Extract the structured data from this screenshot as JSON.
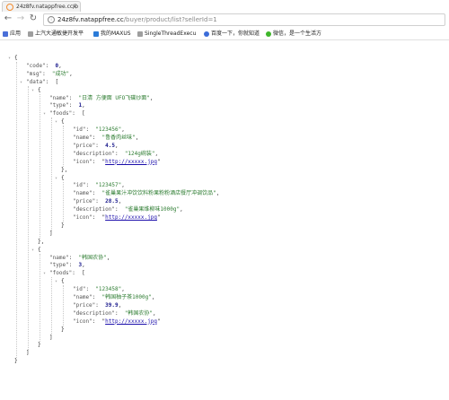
{
  "browser": {
    "tab_title": "24z8fv.natappfree.cc/b",
    "url_host": "24z8fv.natappfree.cc",
    "url_path": "/buyer/product/list?sellerId=1",
    "bookmarks": [
      {
        "label": "应用",
        "color": "#4a6fd8"
      },
      {
        "label": "上汽大通敏捷开发平",
        "color": "#9e9e9e"
      },
      {
        "label": "我的MAXUS",
        "color": "#2b7bd8"
      },
      {
        "label": "SingleThreadExecu",
        "color": "#9e9e9e"
      },
      {
        "label": "百度一下，你就知道",
        "color": "#3b6cd9"
      },
      {
        "label": "微信，是一个生活方",
        "color": "#3fb62a"
      }
    ]
  },
  "json_lines": [
    [
      [
        "p",
        "{"
      ]
    ],
    [
      [
        "k",
        "\"code\""
      ],
      [
        "p",
        ":  "
      ],
      [
        "n",
        "0"
      ],
      [
        "p",
        ","
      ]
    ],
    [
      [
        "k",
        "\"msg\""
      ],
      [
        "p",
        ":  "
      ],
      [
        "s",
        "\"成功\""
      ],
      [
        "p",
        ","
      ]
    ],
    [
      [
        "k",
        "\"data\""
      ],
      [
        "p",
        ":  ["
      ]
    ],
    [
      [
        "p",
        "{"
      ]
    ],
    [
      [
        "k",
        "\"name\""
      ],
      [
        "p",
        ":  "
      ],
      [
        "s",
        "\"日清 方便面 UFO飞碟炒面\""
      ],
      [
        "p",
        ","
      ]
    ],
    [
      [
        "k",
        "\"type\""
      ],
      [
        "p",
        ":  "
      ],
      [
        "n",
        "1"
      ],
      [
        "p",
        ","
      ]
    ],
    [
      [
        "k",
        "\"foods\""
      ],
      [
        "p",
        ":  ["
      ]
    ],
    [
      [
        "p",
        "{"
      ]
    ],
    [
      [
        "k",
        "\"id\""
      ],
      [
        "p",
        ":  "
      ],
      [
        "s",
        "\"123456\""
      ],
      [
        "p",
        ","
      ]
    ],
    [
      [
        "k",
        "\"name\""
      ],
      [
        "p",
        ":  "
      ],
      [
        "s",
        "\"鲁香肉丝味\""
      ],
      [
        "p",
        ","
      ]
    ],
    [
      [
        "k",
        "\"price\""
      ],
      [
        "p",
        ":  "
      ],
      [
        "n",
        "4.5"
      ],
      [
        "p",
        ","
      ]
    ],
    [
      [
        "k",
        "\"description\""
      ],
      [
        "p",
        ":  "
      ],
      [
        "s",
        "\"124g碗装\""
      ],
      [
        "p",
        ","
      ]
    ],
    [
      [
        "k",
        "\"icon\""
      ],
      [
        "p",
        ":  \""
      ],
      [
        "u",
        "http://xxxxx.jpg"
      ],
      [
        "p",
        "\""
      ]
    ],
    [
      [
        "p",
        "},"
      ]
    ],
    [
      [
        "p",
        "{"
      ]
    ],
    [
      [
        "k",
        "\"id\""
      ],
      [
        "p",
        ":  "
      ],
      [
        "s",
        "\"123457\""
      ],
      [
        "p",
        ","
      ]
    ],
    [
      [
        "k",
        "\"name\""
      ],
      [
        "p",
        ":  "
      ],
      [
        "s",
        "\"雀巢果汁冲饮饮料粉果粉粉酒店餐厅冲调饮品\""
      ],
      [
        "p",
        ","
      ]
    ],
    [
      [
        "k",
        "\"price\""
      ],
      [
        "p",
        ":  "
      ],
      [
        "n",
        "28.5"
      ],
      [
        "p",
        ","
      ]
    ],
    [
      [
        "k",
        "\"description\""
      ],
      [
        "p",
        ":  "
      ],
      [
        "s",
        "\"雀巢果维柳味1000g\""
      ],
      [
        "p",
        ","
      ]
    ],
    [
      [
        "k",
        "\"icon\""
      ],
      [
        "p",
        ":  \""
      ],
      [
        "u",
        "http://xxxxx.jpg"
      ],
      [
        "p",
        "\""
      ]
    ],
    [
      [
        "p",
        "}"
      ]
    ],
    [
      [
        "p",
        "]"
      ]
    ],
    [
      [
        "p",
        "},"
      ]
    ],
    [
      [
        "p",
        "{"
      ]
    ],
    [
      [
        "k",
        "\"name\""
      ],
      [
        "p",
        ":  "
      ],
      [
        "s",
        "\"韩国农协\""
      ],
      [
        "p",
        ","
      ]
    ],
    [
      [
        "k",
        "\"type\""
      ],
      [
        "p",
        ":  "
      ],
      [
        "n",
        "3"
      ],
      [
        "p",
        ","
      ]
    ],
    [
      [
        "k",
        "\"foods\""
      ],
      [
        "p",
        ":  ["
      ]
    ],
    [
      [
        "p",
        "{"
      ]
    ],
    [
      [
        "k",
        "\"id\""
      ],
      [
        "p",
        ":  "
      ],
      [
        "s",
        "\"123458\""
      ],
      [
        "p",
        ","
      ]
    ],
    [
      [
        "k",
        "\"name\""
      ],
      [
        "p",
        ":  "
      ],
      [
        "s",
        "\"韩国柚子茶1000g\""
      ],
      [
        "p",
        ","
      ]
    ],
    [
      [
        "k",
        "\"price\""
      ],
      [
        "p",
        ":  "
      ],
      [
        "n",
        "39.9"
      ],
      [
        "p",
        ","
      ]
    ],
    [
      [
        "k",
        "\"description\""
      ],
      [
        "p",
        ":  "
      ],
      [
        "s",
        "\"韩国农协\""
      ],
      [
        "p",
        ","
      ]
    ],
    [
      [
        "k",
        "\"icon\""
      ],
      [
        "p",
        ":  \""
      ],
      [
        "u",
        "http://xxxxx.jpg"
      ],
      [
        "p",
        "\""
      ]
    ],
    [
      [
        "p",
        "}"
      ]
    ],
    [
      [
        "p",
        "]"
      ]
    ],
    [
      [
        "p",
        "}"
      ]
    ],
    [
      [
        "p",
        "]"
      ]
    ],
    [
      [
        "p",
        "}"
      ]
    ]
  ]
}
